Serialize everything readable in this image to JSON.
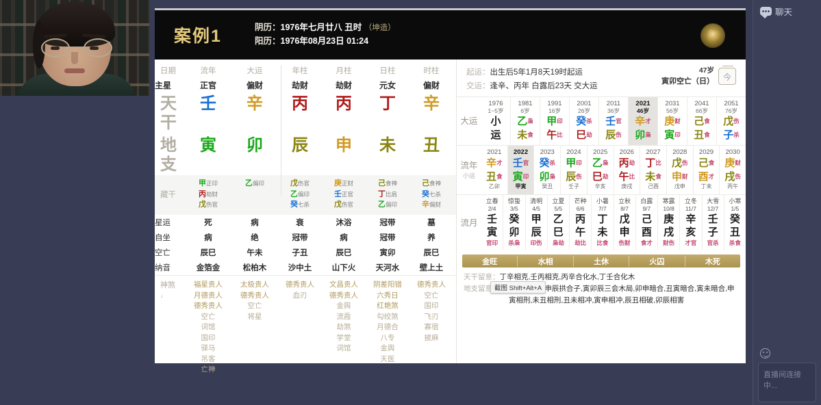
{
  "webcam": {
    "name": "presenter-webcam"
  },
  "chart": {
    "case_title": "案例1",
    "lunar_label": "阴历：",
    "lunar_value": "1976年七月廿八 丑时",
    "gender": "（坤造）",
    "solar_label": "阳历：",
    "solar_value": "1976年08月23日 01:24",
    "row_labels": {
      "date": "日期",
      "zhuxing": "主星",
      "tiangan": "天干",
      "dizhi": "地支",
      "canggan": "藏干",
      "xingyun": "星运",
      "zizuo": "自坐",
      "kongwang": "空亡",
      "nayin": "纳音",
      "shensha": "神煞",
      "shensha_sub": "↓"
    },
    "columns": [
      "流年",
      "大运",
      "年柱",
      "月柱",
      "日柱",
      "时柱"
    ],
    "zhuxing": [
      "正官",
      "偏财",
      "劫财",
      "劫财",
      "元女",
      "偏财"
    ],
    "tiangan": [
      {
        "ch": "壬",
        "color": "#1a6fd4"
      },
      {
        "ch": "辛",
        "color": "#d09a22"
      },
      {
        "ch": "丙",
        "color": "#b01c1c"
      },
      {
        "ch": "丙",
        "color": "#b01c1c"
      },
      {
        "ch": "丁",
        "color": "#b01c1c"
      },
      {
        "ch": "辛",
        "color": "#d09a22"
      }
    ],
    "dizhi": [
      {
        "ch": "寅",
        "color": "#1aa81a"
      },
      {
        "ch": "卯",
        "color": "#1aa81a"
      },
      {
        "ch": "辰",
        "color": "#8a8510"
      },
      {
        "ch": "申",
        "color": "#d09a22"
      },
      {
        "ch": "未",
        "color": "#8a8510"
      },
      {
        "ch": "丑",
        "color": "#8a8510"
      }
    ],
    "canggan": [
      [
        {
          "g": "甲",
          "c": "#1aa81a",
          "s": "正印"
        },
        {
          "g": "丙",
          "c": "#b01c1c",
          "s": "劫财"
        },
        {
          "g": "戊",
          "c": "#8a8510",
          "s": "伤官"
        }
      ],
      [
        {
          "g": "乙",
          "c": "#1aa81a",
          "s": "偏印"
        }
      ],
      [
        {
          "g": "戊",
          "c": "#8a8510",
          "s": "伤官"
        },
        {
          "g": "乙",
          "c": "#1aa81a",
          "s": "偏印"
        },
        {
          "g": "癸",
          "c": "#1a6fd4",
          "s": "七杀"
        }
      ],
      [
        {
          "g": "庚",
          "c": "#d09a22",
          "s": "正财"
        },
        {
          "g": "壬",
          "c": "#1a6fd4",
          "s": "正官"
        },
        {
          "g": "戊",
          "c": "#8a8510",
          "s": "伤官"
        }
      ],
      [
        {
          "g": "己",
          "c": "#8a8510",
          "s": "食神"
        },
        {
          "g": "丁",
          "c": "#b01c1c",
          "s": "比肩"
        },
        {
          "g": "乙",
          "c": "#1aa81a",
          "s": "偏印"
        }
      ],
      [
        {
          "g": "己",
          "c": "#8a8510",
          "s": "食神"
        },
        {
          "g": "癸",
          "c": "#1a6fd4",
          "s": "七杀"
        },
        {
          "g": "辛",
          "c": "#d09a22",
          "s": "偏财"
        }
      ]
    ],
    "xingyun": [
      "死",
      "病",
      "衰",
      "沐浴",
      "冠带",
      "墓"
    ],
    "zizuo": [
      "病",
      "绝",
      "冠带",
      "病",
      "冠带",
      "养"
    ],
    "kongwang": [
      "辰巳",
      "午未",
      "子丑",
      "辰巳",
      "寅卯",
      "辰巳"
    ],
    "nayin": [
      "金箔金",
      "松柏木",
      "沙中土",
      "山下火",
      "天河水",
      "壁上土"
    ],
    "shensha": [
      [
        "福星贵人",
        "月德贵人",
        "德秀贵人",
        "空亡",
        "词馆",
        "国印",
        "驿马",
        "吊客",
        "亡神"
      ],
      [
        "太极贵人",
        "德秀贵人",
        "空亡",
        "将星"
      ],
      [
        "德秀贵人",
        "血刃"
      ],
      [
        "文昌贵人",
        "德秀贵人",
        "金舆",
        "流霞",
        "劫煞",
        "学堂",
        "词馆"
      ],
      [
        "阴差阳错",
        "六秀日",
        "红艳煞",
        "勾绞煞",
        "月德合",
        "八专",
        "金舆",
        "天医"
      ],
      [
        "德秀贵人",
        "空亡",
        "国印",
        "飞刃",
        "寡宿",
        "披麻"
      ]
    ],
    "qiyun": {
      "qi_label": "起运：",
      "qi_value": "出生后5年1月8天19时起运",
      "jiao_label": "交运：",
      "jiao_value": "逢辛、丙年 白露后23天 交大运",
      "age": "47岁",
      "kongwang": "寅卯空亡（日）",
      "cal_glyph": "今"
    },
    "dayun": {
      "label": "大运",
      "cells": [
        {
          "year": "1976",
          "age": "1~5岁",
          "gan": "小",
          "gan_t": "",
          "zhi": "运",
          "zhi_t": "",
          "active": false
        },
        {
          "year": "1981",
          "age": "6岁",
          "gan": "乙",
          "gan_t": "枭",
          "zhi": "未",
          "zhi_t": "食",
          "active": false
        },
        {
          "year": "1991",
          "age": "16岁",
          "gan": "甲",
          "gan_t": "印",
          "zhi": "午",
          "zhi_t": "比",
          "active": false
        },
        {
          "year": "2001",
          "age": "26岁",
          "gan": "癸",
          "gan_t": "杀",
          "zhi": "巳",
          "zhi_t": "劫",
          "active": false
        },
        {
          "year": "2011",
          "age": "36岁",
          "gan": "壬",
          "gan_t": "官",
          "zhi": "辰",
          "zhi_t": "伤",
          "active": false
        },
        {
          "year": "2021",
          "age": "46岁",
          "gan": "辛",
          "gan_t": "才",
          "zhi": "卯",
          "zhi_t": "枭",
          "active": true
        },
        {
          "year": "2031",
          "age": "56岁",
          "gan": "庚",
          "gan_t": "财",
          "zhi": "寅",
          "zhi_t": "印",
          "active": false
        },
        {
          "year": "2041",
          "age": "66岁",
          "gan": "己",
          "gan_t": "食",
          "zhi": "丑",
          "zhi_t": "食",
          "active": false
        },
        {
          "year": "2051",
          "age": "76岁",
          "gan": "戊",
          "gan_t": "伤",
          "zhi": "子",
          "zhi_t": "杀",
          "active": false
        }
      ]
    },
    "liunian": {
      "label": "流年",
      "sub": "小运",
      "cells": [
        {
          "year": "2021",
          "gan": "辛",
          "gan_t": "才",
          "zhi": "丑",
          "zhi_t": "食",
          "xy": "乙卯",
          "active": false
        },
        {
          "year": "2022",
          "gan": "壬",
          "gan_t": "官",
          "zhi": "寅",
          "zhi_t": "印",
          "xy": "甲寅",
          "active": true
        },
        {
          "year": "2023",
          "gan": "癸",
          "gan_t": "杀",
          "zhi": "卯",
          "zhi_t": "枭",
          "xy": "癸丑",
          "active": false
        },
        {
          "year": "2024",
          "gan": "甲",
          "gan_t": "印",
          "zhi": "辰",
          "zhi_t": "伤",
          "xy": "壬子",
          "active": false
        },
        {
          "year": "2025",
          "gan": "乙",
          "gan_t": "枭",
          "zhi": "巳",
          "zhi_t": "劫",
          "xy": "辛亥",
          "active": false
        },
        {
          "year": "2026",
          "gan": "丙",
          "gan_t": "劫",
          "zhi": "午",
          "zhi_t": "比",
          "xy": "庚戌",
          "active": false
        },
        {
          "year": "2027",
          "gan": "丁",
          "gan_t": "比",
          "zhi": "未",
          "zhi_t": "食",
          "xy": "己酉",
          "active": false
        },
        {
          "year": "2028",
          "gan": "戊",
          "gan_t": "伤",
          "zhi": "申",
          "zhi_t": "财",
          "xy": "戊申",
          "active": false
        },
        {
          "year": "2029",
          "gan": "己",
          "gan_t": "食",
          "zhi": "酉",
          "zhi_t": "才",
          "xy": "丁未",
          "active": false
        },
        {
          "year": "2030",
          "gan": "庚",
          "gan_t": "财",
          "zhi": "戌",
          "zhi_t": "伤",
          "xy": "丙午",
          "active": false
        }
      ]
    },
    "liuyue": {
      "label": "流月",
      "cells": [
        {
          "term": "立春",
          "date": "2/4",
          "gan": "壬",
          "zhi": "寅",
          "ss": "官印"
        },
        {
          "term": "惊蛰",
          "date": "3/5",
          "gan": "癸",
          "zhi": "卯",
          "ss": "杀枭"
        },
        {
          "term": "清明",
          "date": "4/5",
          "gan": "甲",
          "zhi": "辰",
          "ss": "印伤"
        },
        {
          "term": "立夏",
          "date": "5/5",
          "gan": "乙",
          "zhi": "巳",
          "ss": "枭劫"
        },
        {
          "term": "芒种",
          "date": "6/6",
          "gan": "丙",
          "zhi": "午",
          "ss": "劫比"
        },
        {
          "term": "小暑",
          "date": "7/7",
          "gan": "丁",
          "zhi": "未",
          "ss": "比食"
        },
        {
          "term": "立秋",
          "date": "8/7",
          "gan": "戊",
          "zhi": "申",
          "ss": "伤财"
        },
        {
          "term": "白露",
          "date": "9/7",
          "gan": "己",
          "zhi": "酉",
          "ss": "食才"
        },
        {
          "term": "寒露",
          "date": "10/8",
          "gan": "庚",
          "zhi": "戌",
          "ss": "财伤"
        },
        {
          "term": "立冬",
          "date": "11/7",
          "gan": "辛",
          "zhi": "亥",
          "ss": "才官"
        },
        {
          "term": "大雪",
          "date": "12/7",
          "gan": "壬",
          "zhi": "子",
          "ss": "官杀"
        },
        {
          "term": "小寒",
          "date": "1/5",
          "gan": "癸",
          "zhi": "丑",
          "ss": "杀食"
        }
      ]
    },
    "wuxing_bar": [
      "金旺",
      "水相",
      "土休",
      "火囚",
      "木死"
    ],
    "notes": {
      "tiangan_label": "天干留意：",
      "tiangan_value": "丁辛相克,壬丙相克,丙辛合化水,丁壬合化木",
      "dizhi_label": "地支留意：",
      "dizhi_value": "卯未半合木局,申辰拱合子,寅卯辰三会木局,卯申暗合,丑寅暗合,寅未暗合,申",
      "dizhi_value2": "寅相刑,未丑相刑,丑未相冲,寅申相冲,辰丑相破,卯辰相害"
    },
    "tooltip": "截图 Shift+Alt+A"
  },
  "chat": {
    "title": "聊天",
    "input_placeholder": "直播间连接中..."
  },
  "colors": {
    "accent_gold": "#b49c5d",
    "panel_bg": "#3b3f58",
    "header_bg": "#0b0b0b"
  }
}
